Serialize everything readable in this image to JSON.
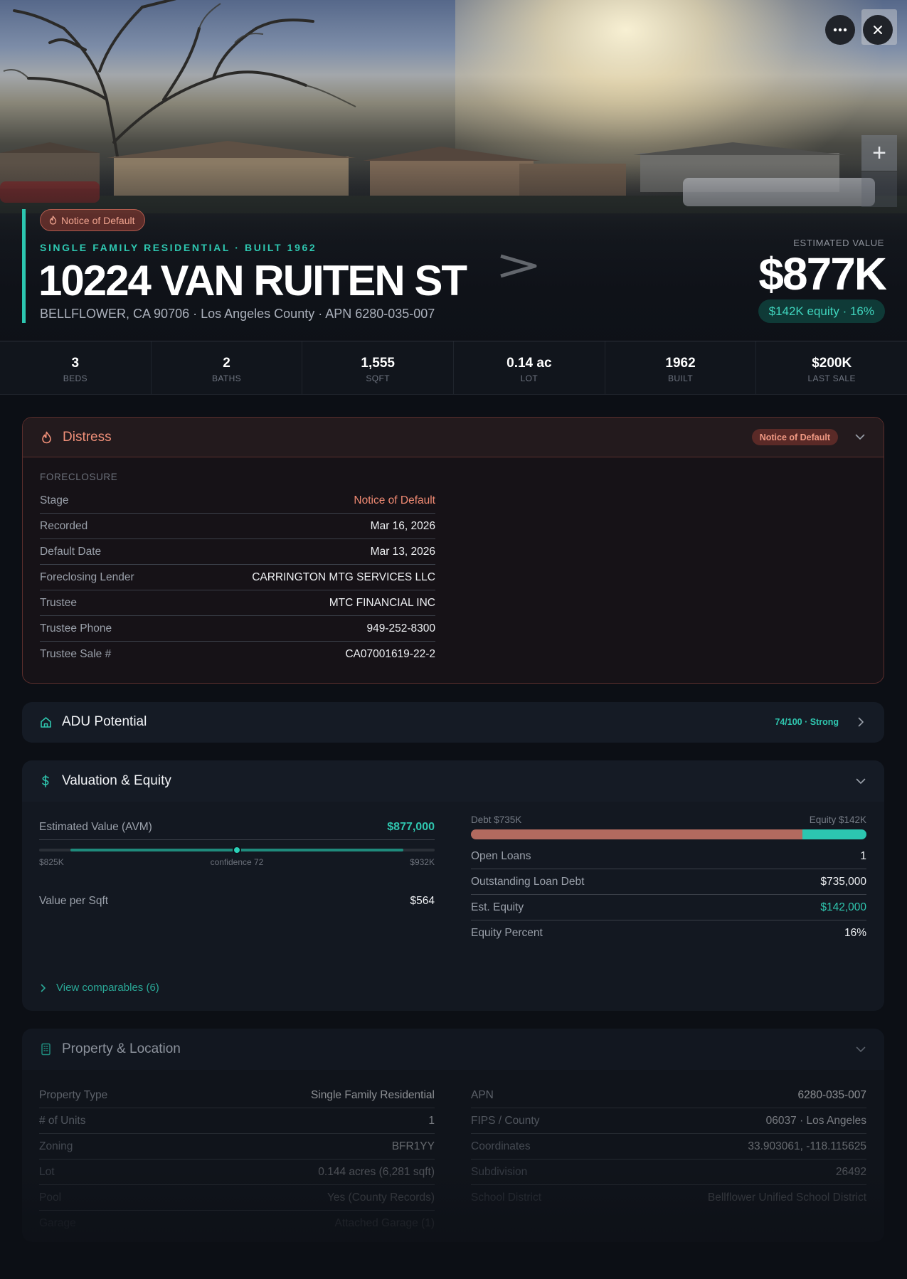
{
  "hero": {
    "badge": "Notice of Default",
    "subtitle": "SINGLE FAMILY RESIDENTIAL · BUILT 1962",
    "title": "10224 VAN RUITEN ST",
    "address": "BELLFLOWER, CA 90706 · Los Angeles County · APN 6280-035-007",
    "estimated_label": "ESTIMATED VALUE",
    "estimated_value": "$877K",
    "equity_pill": "$142K equity · 16%",
    "more_icon": "more-horizontal-icon",
    "close_icon": "close-icon",
    "zoom_in_label": "+"
  },
  "stats": [
    {
      "value": "3",
      "label": "BEDS"
    },
    {
      "value": "2",
      "label": "BATHS"
    },
    {
      "value": "1,555",
      "label": "SQFT"
    },
    {
      "value": "0.14 ac",
      "label": "LOT"
    },
    {
      "value": "1962",
      "label": "BUILT"
    },
    {
      "value": "$200K",
      "label": "LAST SALE"
    }
  ],
  "distress": {
    "title": "Distress",
    "badge": "Notice of Default",
    "section": "FORECLOSURE",
    "rows": [
      {
        "k": "Stage",
        "v": "Notice of Default"
      },
      {
        "k": "Recorded",
        "v": "Mar 16, 2026"
      },
      {
        "k": "Default Date",
        "v": "Mar 13, 2026"
      },
      {
        "k": "Foreclosing Lender",
        "v": "CARRINGTON MTG SERVICES LLC"
      },
      {
        "k": "Trustee",
        "v": "MTC FINANCIAL INC"
      },
      {
        "k": "Trustee Phone",
        "v": "949-252-8300"
      },
      {
        "k": "Trustee Sale #",
        "v": "CA07001619-22-2"
      }
    ]
  },
  "adu": {
    "title": "ADU Potential",
    "score": "74/100 · Strong"
  },
  "valuation": {
    "title": "Valuation & Equity",
    "avm_label": "Estimated Value (AVM)",
    "avm_value": "$877,000",
    "range_low": "$825K",
    "range_high": "$932K",
    "confidence": "confidence 72",
    "range_fill_start": 0.08,
    "range_fill_end": 0.92,
    "range_point": 0.5,
    "value_per_sqft_label": "Value per Sqft",
    "value_per_sqft": "$564",
    "debt_label": "Debt $735K",
    "equity_label": "Equity $142K",
    "debt_fraction": 0.838,
    "rows": [
      {
        "k": "Open Loans",
        "v": "1"
      },
      {
        "k": "Outstanding Loan Debt",
        "v": "$735,000"
      },
      {
        "k": "Est. Equity",
        "v": "$142,000"
      },
      {
        "k": "Equity Percent",
        "v": "16%"
      }
    ],
    "comps_link": "View comparables (6)"
  },
  "property": {
    "title": "Property & Location",
    "left": [
      {
        "k": "Property Type",
        "v": "Single Family Residential"
      },
      {
        "k": "# of Units",
        "v": "1"
      },
      {
        "k": "Zoning",
        "v": "BFR1YY"
      },
      {
        "k": "Lot",
        "v": "0.144 acres (6,281 sqft)"
      },
      {
        "k": "Pool",
        "v": "Yes (County Records)"
      },
      {
        "k": "Garage",
        "v": "Attached Garage (1)"
      }
    ],
    "right": [
      {
        "k": "APN",
        "v": "6280-035-007"
      },
      {
        "k": "FIPS / County",
        "v": "06037 · Los Angeles"
      },
      {
        "k": "Coordinates",
        "v": "33.903061, -118.115625"
      },
      {
        "k": "Subdivision",
        "v": "26492"
      },
      {
        "k": "School District",
        "v": "Bellflower Unified School District"
      }
    ]
  },
  "colors": {
    "accent": "#2cc6b0",
    "distress": "#ef8f78",
    "debt": "#b26a5f"
  }
}
